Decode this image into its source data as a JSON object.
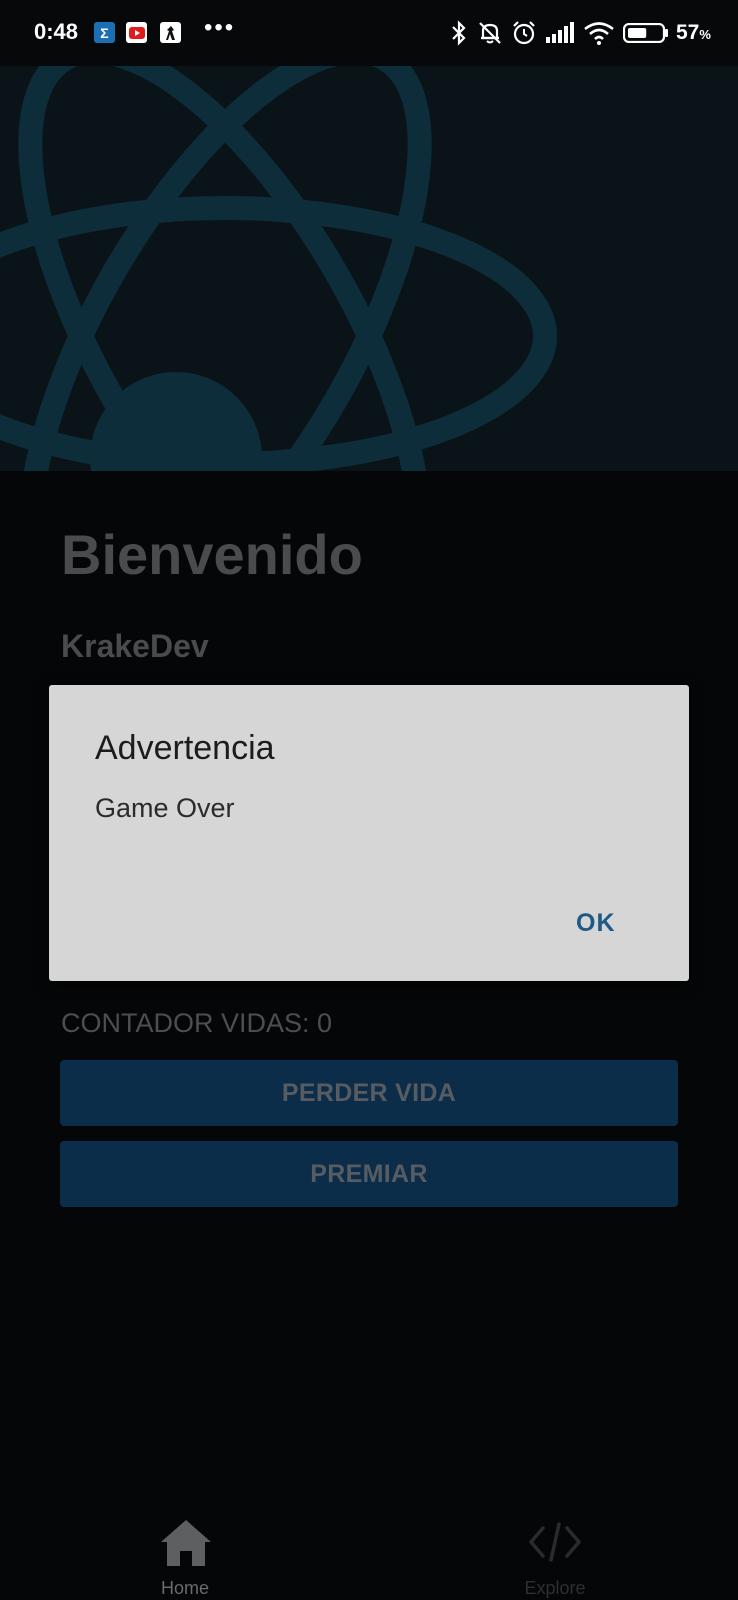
{
  "status_bar": {
    "time": "0:48",
    "notification_icons": [
      "sigma-app-icon",
      "youtube-icon",
      "app-icon"
    ],
    "more": "•••",
    "right_icons": [
      "bluetooth-icon",
      "bell-off-icon",
      "alarm-icon",
      "signal-icon",
      "wifi-icon",
      "battery-icon"
    ],
    "battery_percent": "57",
    "battery_unit": "%",
    "battery_level": 0.57
  },
  "main": {
    "title": "Bienvenido",
    "subtitle": "KrakeDev",
    "counter": "CONTADOR VIDAS: 0",
    "buttons": {
      "lose_life": "PERDER VIDA",
      "reward": "PREMIAR"
    }
  },
  "dialog": {
    "title": "Advertencia",
    "message": "Game Over",
    "ok": "OK"
  },
  "tabs": [
    {
      "label": "Home",
      "icon": "home-icon",
      "active": true
    },
    {
      "label": "Explore",
      "icon": "code-icon",
      "active": false
    }
  ],
  "colors": {
    "background": "#050607",
    "header_bg": "#0a1418",
    "atom_logo": "#0d2d3a",
    "button_bg": "#0b2d4a",
    "dialog_bg": "#d6d6d6",
    "dialog_ok": "#1e5a85"
  }
}
